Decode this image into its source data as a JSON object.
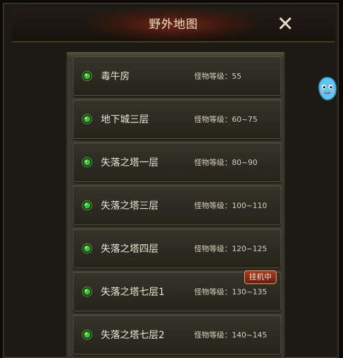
{
  "window": {
    "title": "野外地图",
    "close_glyph": "✕"
  },
  "maps": [
    {
      "name": "毒牛房",
      "level": "怪物等级：55",
      "badge": ""
    },
    {
      "name": "地下城三层",
      "level": "怪物等级：60~75",
      "badge": ""
    },
    {
      "name": "失落之塔一层",
      "level": "怪物等级：80~90",
      "badge": ""
    },
    {
      "name": "失落之塔三层",
      "level": "怪物等级：100~110",
      "badge": ""
    },
    {
      "name": "失落之塔四层",
      "level": "怪物等级：120~125",
      "badge": ""
    },
    {
      "name": "失落之塔七层1",
      "level": "怪物等级：130~135",
      "badge": "挂机中"
    },
    {
      "name": "失落之塔七层2",
      "level": "怪物等级：140~145",
      "badge": ""
    }
  ],
  "colors": {
    "accent_green": "#34c82a",
    "badge_red": "#a83a26"
  },
  "icons": {
    "row_marker": "green-gem-icon",
    "close": "close-icon",
    "mascot": "blue-mascot-icon"
  }
}
